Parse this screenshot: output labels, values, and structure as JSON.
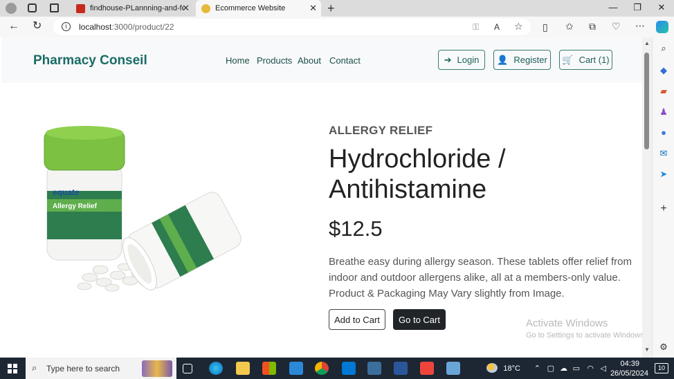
{
  "browser": {
    "tabs": [
      {
        "label": "findhouse-PLannning-and-featur",
        "active": false
      },
      {
        "label": "Ecommerce Website",
        "active": true
      }
    ],
    "url_host": "localhost",
    "url_path": ":3000/product/22"
  },
  "navbar": {
    "brand": "Pharmacy Conseil",
    "links": [
      "Home",
      "Products",
      "About",
      "Contact"
    ],
    "login_label": "Login",
    "register_label": "Register",
    "cart_label": "Cart (1)"
  },
  "product": {
    "category": "ALLERGY RELIEF",
    "title": "Hydrochloride / Antihistamine",
    "price": "$12.5",
    "description": "Breathe easy during allergy season. These tablets offer relief from indoor and outdoor allergens alike, all at a members-only value. Product & Packaging May Vary slightly from Image.",
    "add_to_cart_label": "Add to Cart",
    "go_to_cart_label": "Go to Cart",
    "image_brand": "equate",
    "image_label": "Allergy Relief"
  },
  "watermark": {
    "line1": "Activate Windows",
    "line2": "Go to Settings to activate Windows."
  },
  "taskbar": {
    "search_placeholder": "Type here to search",
    "temperature": "18°C",
    "time": "04:39",
    "date": "26/05/2024",
    "notification_count": "10"
  },
  "colors": {
    "brand": "#1a6b66",
    "nav_bg": "#f8f9fa",
    "dark_button": "#212529"
  }
}
